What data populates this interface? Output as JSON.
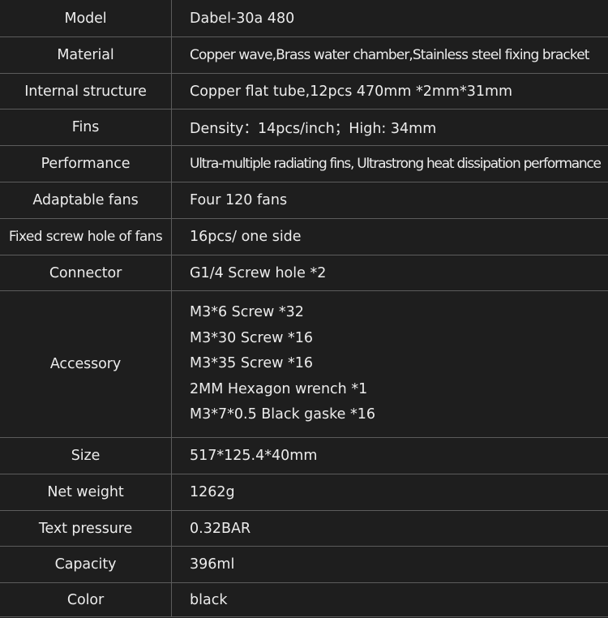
{
  "rows": [
    {
      "label": "Model",
      "value": "Dabel-30a 480"
    },
    {
      "label": "Material",
      "value": "Copper wave,Brass water chamber,Stainless steel fixing bracket"
    },
    {
      "label": "Internal structure",
      "value": "Copper flat tube,12pcs  470mm *2mm*31mm"
    },
    {
      "label": "Fins",
      "value": "Density：14pcs/inch；High: 34mm"
    },
    {
      "label": "Performance",
      "value": "Ultra-multiple radiating fins, Ultrastrong heat dissipation performance"
    },
    {
      "label": "Adaptable fans",
      "value": "Four 120 fans"
    },
    {
      "label": "Fixed screw hole of fans",
      "value": "16pcs/ one side"
    },
    {
      "label": "Connector",
      "value": "G1/4 Screw hole *2"
    },
    {
      "label": "Accessory",
      "values": [
        "M3*6 Screw *32",
        "M3*30 Screw *16",
        "M3*35 Screw *16",
        "2MM Hexagon wrench *1",
        "M3*7*0.5 Black gaske *16"
      ]
    },
    {
      "label": "Size",
      "value": "517*125.4*40mm"
    },
    {
      "label": "Net weight",
      "value": "1262g"
    },
    {
      "label": "Text pressure",
      "value": "0.32BAR"
    },
    {
      "label": "Capacity",
      "value": "396ml"
    },
    {
      "label": "Color",
      "value": "black"
    }
  ],
  "colors": {
    "background": "#1e1e1e",
    "text": "#ececec",
    "border": "#5c5c5c"
  }
}
